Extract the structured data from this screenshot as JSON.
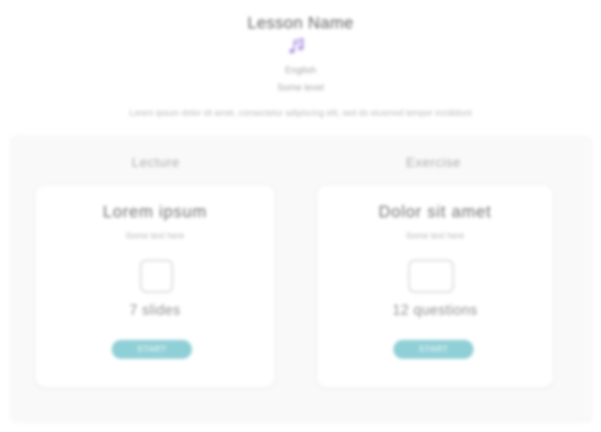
{
  "lesson": {
    "title": "Lesson Name",
    "subject": "English",
    "level": "Some level",
    "description": "Lorem ipsum dolor sit amet, consectetur adipiscing elit, sed do eiusmod tempor incididunt",
    "icon": "music-note-icon"
  },
  "columns": {
    "lecture": {
      "label": "Lecture",
      "card": {
        "title": "Lorem ipsum",
        "subtitle": "Some text here",
        "icon": "video-square-icon",
        "count": "7 slides",
        "button_label": "START"
      }
    },
    "exercise": {
      "label": "Exercise",
      "card": {
        "title": "Dolor sit amet",
        "subtitle": "Some text here",
        "icon": "exercise-screen-icon",
        "count": "12 questions",
        "button_label": "START"
      }
    }
  },
  "colors": {
    "accent": "#8fcfd6",
    "icon_purple": "#b59ee6",
    "panel_background": "#f9f9f9"
  }
}
